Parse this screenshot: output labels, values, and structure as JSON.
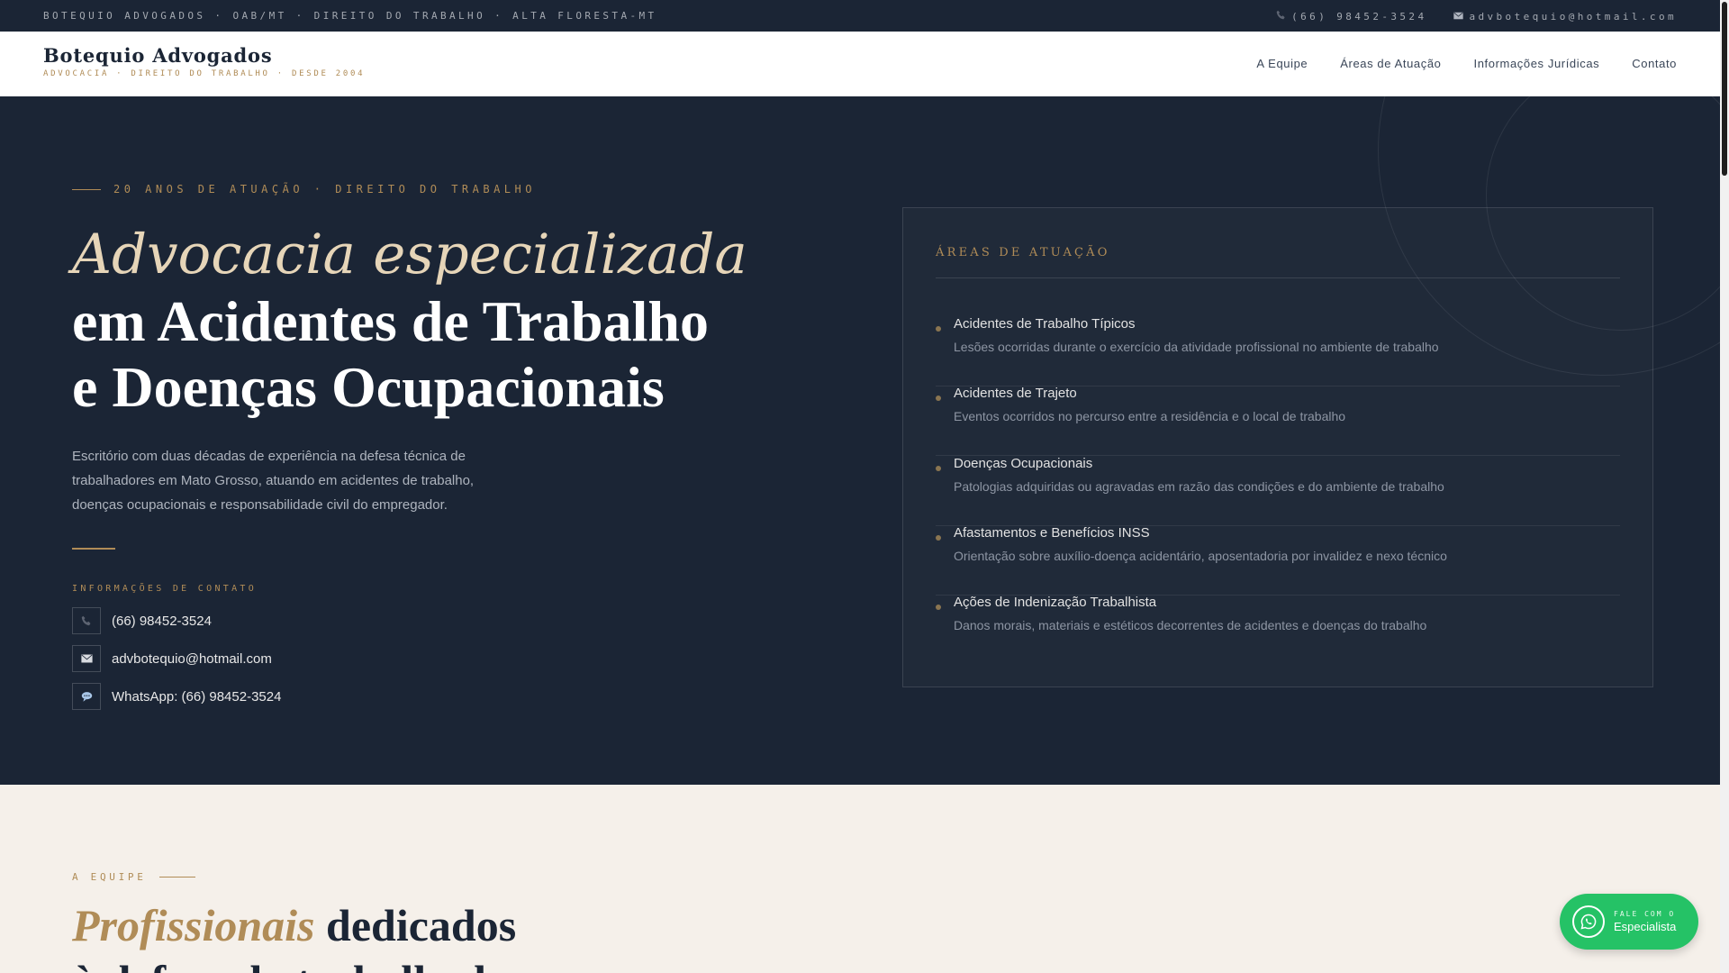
{
  "topbar": {
    "left_text": "BOTEQUIO ADVOGADOS · OAB/MT · DIREITO DO TRABALHO · ALTA FLORESTA-MT",
    "phone": "(66) 98452-3524",
    "email": "advbotequio@hotmail.com"
  },
  "header": {
    "brand": "Botequio Advogados",
    "tagline": "ADVOCACIA · DIREITO DO TRABALHO · DESDE 2004",
    "nav": [
      "A Equipe",
      "Áreas de Atuação",
      "Informações Jurídicas",
      "Contato"
    ]
  },
  "hero": {
    "eyebrow": "20 ANOS DE ATUAÇÃO · DIREITO DO TRABALHO",
    "title_italic": "Advocacia especializada",
    "title_line2": "em Acidentes de Trabalho",
    "title_line3": "e Doenças Ocupacionais",
    "description": "Escritório com duas décadas de experiência na defesa técnica de trabalhadores em Mato Grosso, atuando em acidentes de trabalho, doenças ocupacionais e responsabilidade civil do empregador.",
    "contact_title": "INFORMAÇÕES DE CONTATO",
    "contacts": [
      {
        "icon": "phone-icon",
        "text": "(66) 98452-3524"
      },
      {
        "icon": "mail-icon",
        "text": "advbotequio@hotmail.com"
      },
      {
        "icon": "chat-icon",
        "text": "WhatsApp: (66) 98452-3524"
      }
    ]
  },
  "areas": {
    "title": "ÁREAS DE ATUAÇÃO",
    "items": [
      {
        "title": "Acidentes de Trabalho Típicos",
        "desc": "Lesões ocorridas durante o exercício da atividade profissional no ambiente de trabalho"
      },
      {
        "title": "Acidentes de Trajeto",
        "desc": "Eventos ocorridos no percurso entre a residência e o local de trabalho"
      },
      {
        "title": "Doenças Ocupacionais",
        "desc": "Patologias adquiridas ou agravadas em razão das condições e do ambiente de trabalho"
      },
      {
        "title": "Afastamentos e Benefícios INSS",
        "desc": "Orientação sobre auxílio-doença acidentário, aposentadoria por invalidez e nexo técnico"
      },
      {
        "title": "Ações de Indenização Trabalhista",
        "desc": "Danos morais, materiais e estéticos decorrentes de acidentes e doenças do trabalho"
      }
    ]
  },
  "team": {
    "eyebrow": "A EQUIPE",
    "title_italic": "Profissionais",
    "title_rest": " dedicados à defesa do trabalhador"
  },
  "whatsapp": {
    "small": "FALE COM O",
    "big": "Especialista"
  },
  "colors": {
    "navy": "#1b2535",
    "gold": "#b08c57",
    "cream": "#f5f0ea",
    "whatsapp_green": "#25c266"
  }
}
